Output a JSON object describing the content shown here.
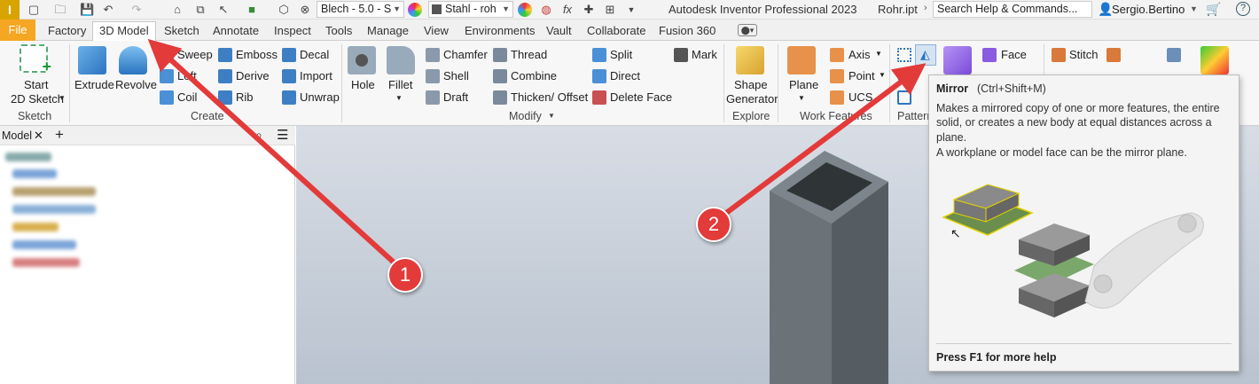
{
  "titlebar": {
    "app_title": "Autodesk Inventor Professional 2023",
    "file_name": "Rohr.ipt",
    "material_dropdown": "Blech - 5.0 - S",
    "appearance_dropdown": "Stahl - roh",
    "search_placeholder": "Search Help & Commands...",
    "user_name": "Sergio.Bertino"
  },
  "tabs": [
    "File",
    "Factory",
    "3D Model",
    "Sketch",
    "Annotate",
    "Inspect",
    "Tools",
    "Manage",
    "View",
    "Environments",
    "Vault",
    "Collaborate",
    "Fusion 360"
  ],
  "active_tab": "3D Model",
  "ribbon": {
    "sketch": {
      "start": "Start",
      "sketch2d": "2D Sketch",
      "group": "Sketch"
    },
    "create": {
      "extrude": "Extrude",
      "revolve": "Revolve",
      "sweep": "Sweep",
      "loft": "Loft",
      "coil": "Coil",
      "emboss": "Emboss",
      "derive": "Derive",
      "rib": "Rib",
      "decal": "Decal",
      "import": "Import",
      "unwrap": "Unwrap",
      "group": "Create"
    },
    "modify": {
      "hole": "Hole",
      "fillet": "Fillet",
      "chamfer": "Chamfer",
      "shell": "Shell",
      "draft": "Draft",
      "thread": "Thread",
      "combine": "Combine",
      "thicken": "Thicken/ Offset",
      "split": "Split",
      "direct": "Direct",
      "delete_face": "Delete Face",
      "mark": "Mark",
      "group": "Modify"
    },
    "explore": {
      "shape": "Shape",
      "generator": "Generator",
      "group": "Explore"
    },
    "work": {
      "plane": "Plane",
      "axis": "Axis",
      "point": "Point",
      "ucs": "UCS",
      "group": "Work Features"
    },
    "pattern": {
      "group": "Pattern"
    },
    "surface": {
      "face": "Face",
      "stitch": "Stitch"
    }
  },
  "panel": {
    "tab_label": "Model"
  },
  "tooltip": {
    "title": "Mirror",
    "shortcut": "(Ctrl+Shift+M)",
    "desc1": "Makes a mirrored copy of one or more features, the entire",
    "desc2": "solid, or creates a new body at equal distances across a plane.",
    "desc3": "A workplane or model face can be the mirror plane.",
    "help": "Press F1 for more help"
  },
  "annotations": {
    "badge1": "1",
    "badge2": "2",
    "arrow_color": "#e33a3a"
  }
}
